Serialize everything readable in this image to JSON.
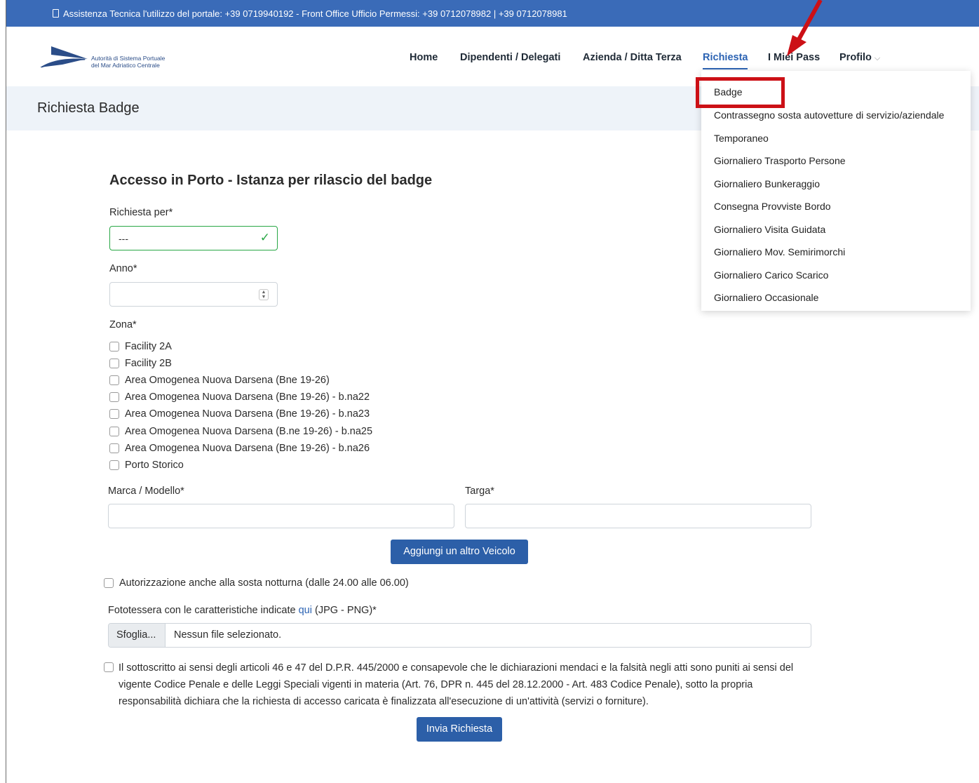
{
  "topbar": {
    "text": "Assistenza Tecnica l'utilizzo del portale: +39 0719940192 - Front Office Ufficio Permessi: +39 0712078982 | +39 0712078981"
  },
  "header": {
    "logo_line1": "Autorità di Sistema Portuale",
    "logo_line2": "del Mar Adriatico Centrale",
    "nav": {
      "home": "Home",
      "dipendenti": "Dipendenti / Delegati",
      "azienda": "Azienda / Ditta Terza",
      "richiesta": "Richiesta",
      "pass": "I Miei Pass",
      "profilo": "Profilo"
    },
    "chevron": "⌵"
  },
  "page_title": "Richiesta Badge",
  "form": {
    "heading": "Accesso in Porto - Istanza per rilascio del badge",
    "richiesta_per_label": "Richiesta per*",
    "richiesta_per_value": "---",
    "anno_label": "Anno*",
    "zona_label": "Zona*",
    "zone": [
      "Facility 2A",
      "Facility 2B",
      "Area Omogenea Nuova Darsena (Bne 19-26)",
      "Area Omogenea Nuova Darsena (Bne 19-26) - b.na22",
      "Area Omogenea Nuova Darsena (Bne 19-26) - b.na23",
      "Area Omogenea Nuova Darsena (B.ne 19-26) - b.na25",
      "Area Omogenea Nuova Darsena (Bne 19-26) - b.na26",
      "Porto Storico"
    ],
    "marca_label": "Marca / Modello*",
    "targa_label": "Targa*",
    "add_vehicle_button": "Aggiungi un altro Veicolo",
    "notturna_label": "Autorizzazione anche alla sosta notturna (dalle 24.00 alle 06.00)",
    "foto_label_pre": "Fototessera con le caratteristiche indicate",
    "foto_link": "qui",
    "foto_label_post": "(JPG - PNG)*",
    "browse_button": "Sfoglia...",
    "file_status": "Nessun file selezionato.",
    "declaration": "Il sottoscritto ai sensi degli articoli 46 e 47 del D.P.R. 445/2000 e consapevole che le dichiarazioni mendaci e la falsità negli atti sono puniti ai sensi del vigente Codice Penale e delle Leggi Speciali vigenti in materia (Art. 76, DPR n. 445 del 28.12.2000 - Art. 483 Codice Penale), sotto la propria responsabilità dichiara che la richiesta di accesso caricata è finalizzata all'esecuzione di un'attività (servizi o forniture).",
    "submit_button": "Invia Richiesta"
  },
  "dropdown": {
    "items": [
      "Badge",
      "Contrassegno sosta autovetture di servizio/aziendale",
      "Temporaneo",
      "Giornaliero Trasporto Persone",
      "Giornaliero Bunkeraggio",
      "Consegna Provviste Bordo",
      "Giornaliero Visita Guidata",
      "Giornaliero Mov. Semirimorchi",
      "Giornaliero Carico Scarico",
      "Giornaliero Occasionale"
    ]
  },
  "colors": {
    "topbar": "#3a6bb8",
    "accent": "#2c63b3",
    "button": "#2c5fa8",
    "valid": "#28a745",
    "highlight": "#cc1016"
  }
}
